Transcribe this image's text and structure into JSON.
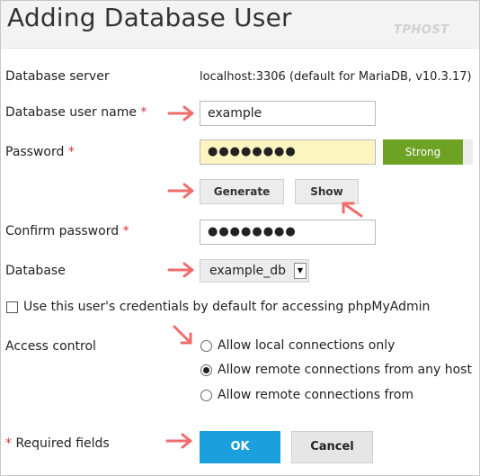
{
  "header": {
    "title": "Adding Database User",
    "watermark": "TPHOST"
  },
  "form": {
    "required_mark": "*",
    "server": {
      "label": "Database server",
      "value": "localhost:3306 (default for MariaDB, v10.3.17)"
    },
    "username": {
      "label": "Database user name",
      "value": "example"
    },
    "password": {
      "label": "Password",
      "masked_value": "●●●●●●●●",
      "strength": "Strong",
      "strength_color": "#6ea225"
    },
    "buttons": {
      "generate": "Generate",
      "show": "Show"
    },
    "confirm": {
      "label": "Confirm password",
      "masked_value": "●●●●●●●●"
    },
    "database": {
      "label": "Database",
      "selected": "example_db"
    },
    "phpmyadmin": {
      "label": "Use this user's credentials by default for accessing phpMyAdmin",
      "checked": false
    },
    "access": {
      "label": "Access control",
      "options": [
        {
          "label": "Allow local connections only",
          "selected": false
        },
        {
          "label": "Allow remote connections from any host",
          "selected": true
        },
        {
          "label": "Allow remote connections from",
          "selected": false
        }
      ]
    },
    "required_note": "Required fields",
    "ok": "OK",
    "cancel": "Cancel"
  },
  "colors": {
    "ok_button": "#1aa0dc",
    "annotation_arrow": "#f26b6b",
    "required": "#d9343f"
  }
}
